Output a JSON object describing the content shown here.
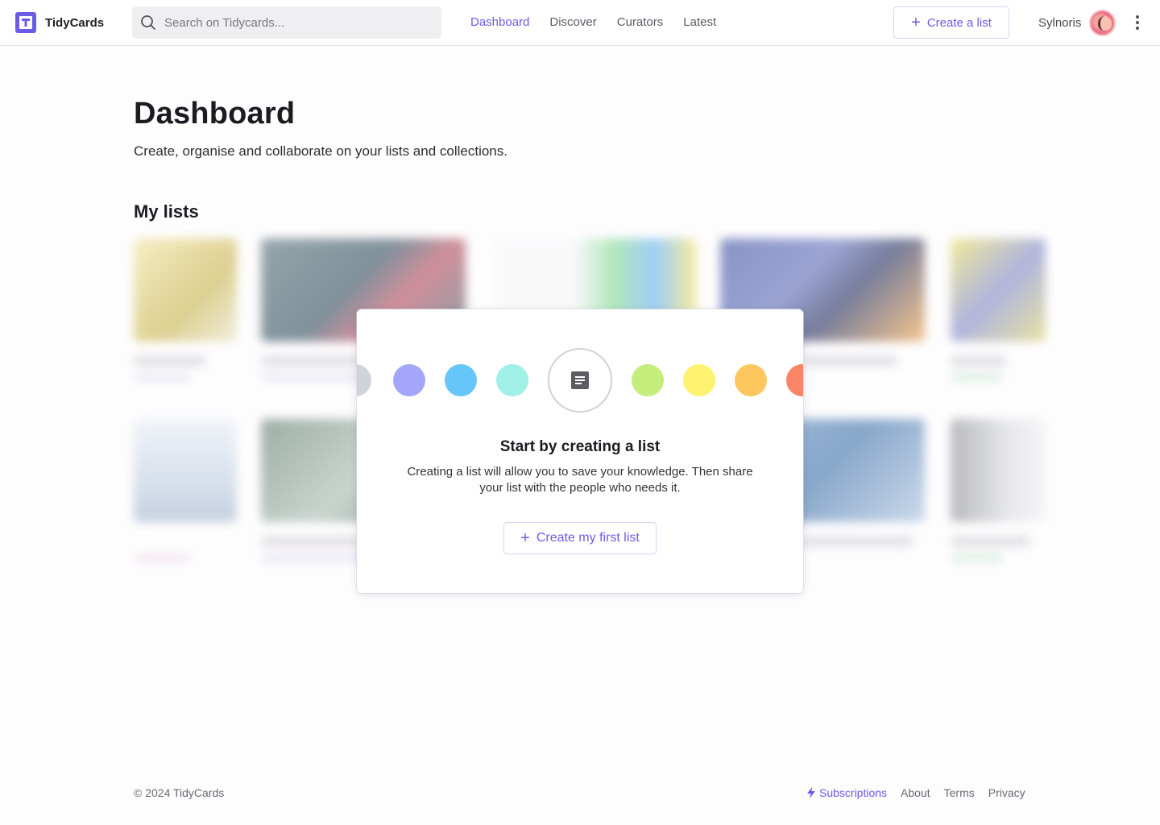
{
  "app": {
    "name": "TidyCards",
    "accent_color": "#6b5ce7"
  },
  "header": {
    "search_placeholder": "Search on Tidycards...",
    "nav": [
      {
        "label": "Dashboard",
        "active": true
      },
      {
        "label": "Discover",
        "active": false
      },
      {
        "label": "Curators",
        "active": false
      },
      {
        "label": "Latest",
        "active": false
      }
    ],
    "create_label": "Create a list",
    "user_name": "Sylnoris"
  },
  "main": {
    "title": "Dashboard",
    "subtitle": "Create, organise and collaborate on your lists and collections.",
    "section_title": "My lists"
  },
  "empty_state": {
    "title": "Start by creating a list",
    "text": "Creating a list will allow you to save your knowledge. Then share your list with the people who needs it.",
    "cta_label": "Create my first list",
    "icon": "document-icon",
    "color_dots": [
      "#cfd3da",
      "#a3a6fb",
      "#66c6f9",
      "#9ff0e6",
      "#c4ee7c",
      "#fdf371",
      "#fdc75e",
      "#fa8466"
    ]
  },
  "footer": {
    "copyright": "© 2024 TidyCards",
    "links": [
      {
        "label": "Subscriptions",
        "icon": "bolt-icon",
        "accent": true
      },
      {
        "label": "About",
        "accent": false
      },
      {
        "label": "Terms",
        "accent": false
      },
      {
        "label": "Privacy",
        "accent": false
      }
    ]
  }
}
